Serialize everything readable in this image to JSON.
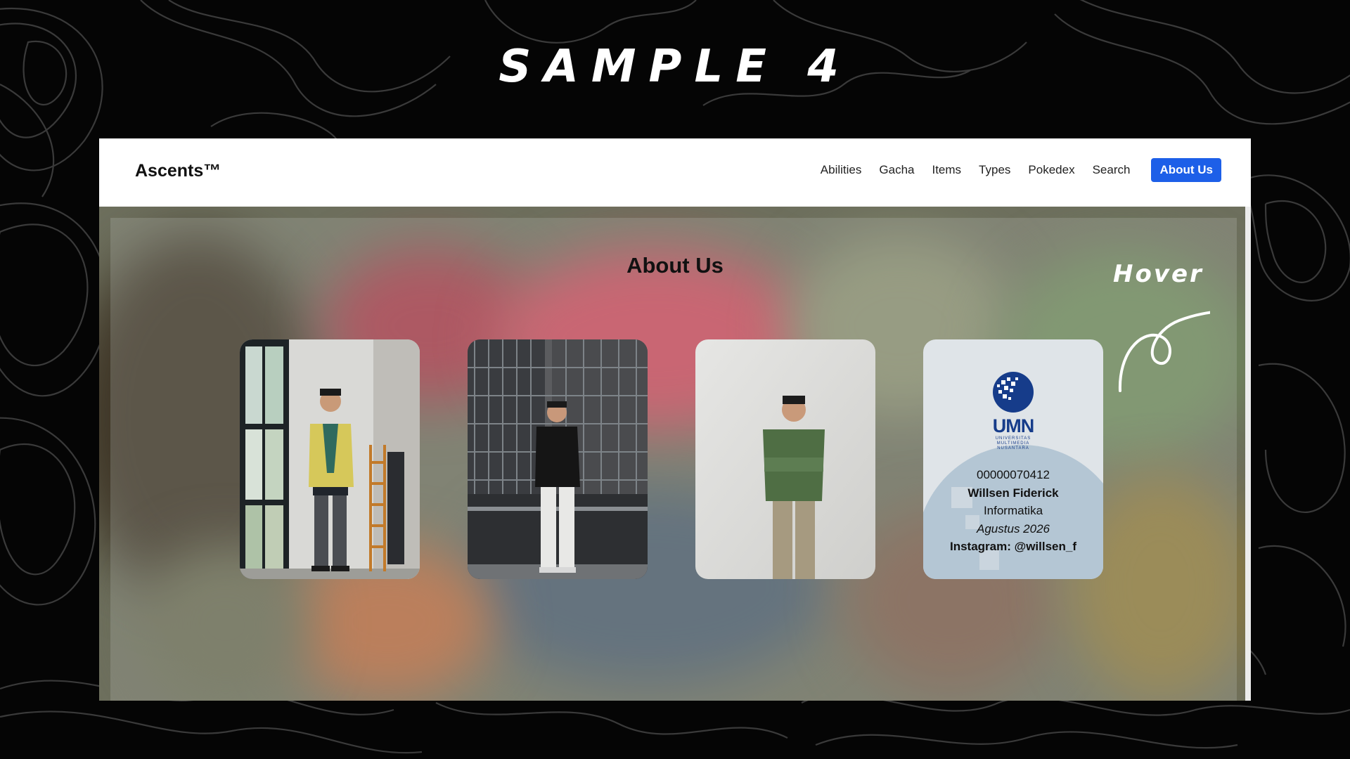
{
  "slide": {
    "title": "SAMPLE 4"
  },
  "navbar": {
    "brand": "Ascents™",
    "links": [
      "Abilities",
      "Gacha",
      "Items",
      "Types",
      "Pokedex",
      "Search"
    ],
    "active": "About Us"
  },
  "main": {
    "title": "About Us",
    "hover_note": "Hover",
    "info_card": {
      "logo_text": "UMN",
      "logo_sub_lines": [
        "UNIVERSITAS",
        "MULTIMEDIA",
        "NUSANTARA"
      ],
      "student_id": "00000070412",
      "name": "Willsen Fiderick",
      "major": "Informatika",
      "date": "Agustus 2026",
      "instagram": "Instagram: @willsen_f"
    }
  },
  "colors": {
    "accent": "#1d5fe8",
    "page_bg": "#050505",
    "umn_blue": "#163c8a"
  }
}
